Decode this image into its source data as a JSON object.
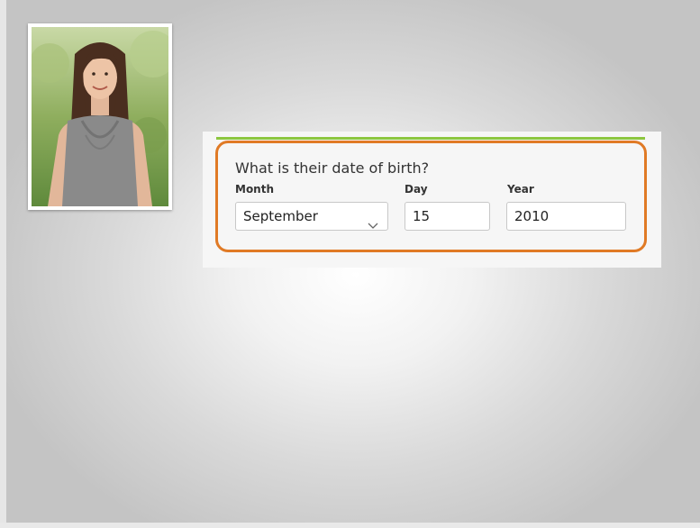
{
  "form": {
    "question": "What is their date of birth?",
    "month": {
      "label": "Month",
      "value": "September"
    },
    "day": {
      "label": "Day",
      "value": "15"
    },
    "year": {
      "label": "Year",
      "value": "2010"
    }
  },
  "colors": {
    "accent_green": "#8cc63f",
    "highlight_orange": "#e07a25"
  },
  "icons": {
    "month_dropdown": "chevron-down-icon"
  }
}
